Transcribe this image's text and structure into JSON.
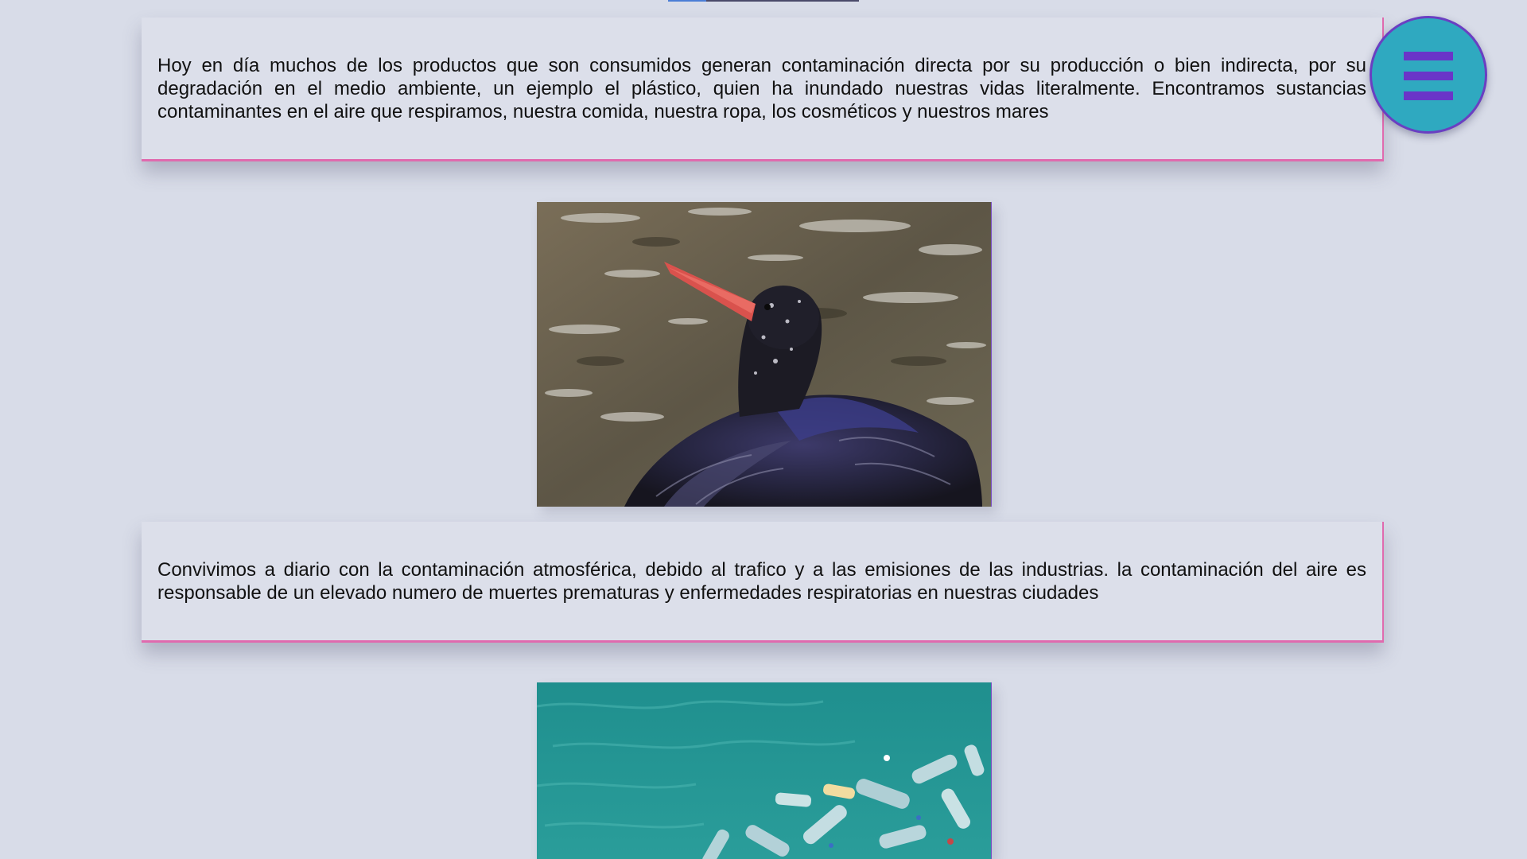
{
  "menu": {
    "icon": "hamburger-menu-icon",
    "button_color": "#2fa9c0",
    "bar_color": "#6a35c8",
    "border_color": "#6a3fc2"
  },
  "sections": [
    {
      "text": "Hoy en día muchos de los productos que son consumidos generan contaminación directa por su producción o bien indirecta, por su degradación en el medio ambiente, un ejemplo el plástico, quien ha inundado nuestras vidas literalmente. Encontramos sustancias contaminantes en el aire que respiramos, nuestra comida, nuestra ropa, los cosméticos y nuestros mares"
    },
    {
      "text": "Convivimos a diario con la contaminación atmosférica, debido al trafico y a las emisiones de las industrias. la contaminación del aire es responsable de un elevado numero de muertes prematuras y enfermedades respiratorias en nuestras ciudades"
    }
  ],
  "images": [
    {
      "subject": "oil-covered-bird-photo"
    },
    {
      "subject": "plastic-bottles-in-sea-photo"
    }
  ],
  "colors": {
    "background": "#d8dce8",
    "card_border": "#e06aae"
  }
}
